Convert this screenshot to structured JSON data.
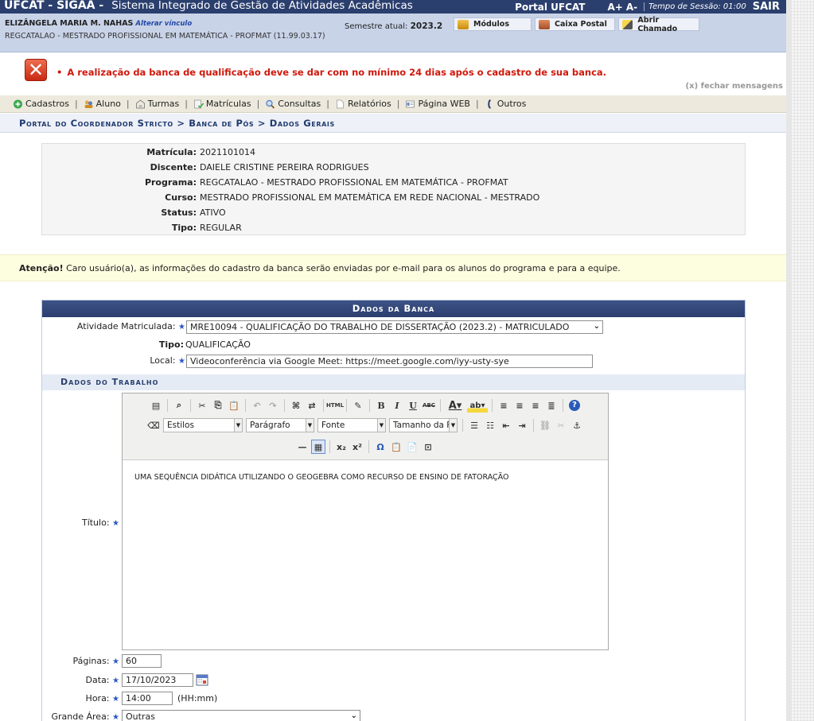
{
  "topbar": {
    "system_name": "UFCAT - SIGAA -",
    "system_full": "Sistema Integrado de Gestão de Atividades Acadêmicas",
    "portal": "Portal UFCAT",
    "font_plus": "A+",
    "font_minus": "A-",
    "session": "Tempo de Sessão: 01:00",
    "logout": "SAIR"
  },
  "user": {
    "name": "ELIZÂNGELA MARIA M. NAHAS",
    "change_link": "Alterar vínculo",
    "program": "REGCATALAO - MESTRADO PROFISSIONAL EM MATEMÁTICA - PROFMAT (11.99.03.17)",
    "semester_label": "Semestre atual:",
    "semester": "2023.2",
    "buttons": {
      "modules": "Módulos",
      "mailbox": "Caixa Postal",
      "ticket": "Abrir Chamado"
    }
  },
  "message": {
    "error": "A realização da banca de qualificação deve se dar com no mínimo 24 dias após o cadastro de sua banca.",
    "close": "(x) fechar mensagens"
  },
  "menu": [
    {
      "label": "Cadastros",
      "icon": "plus-circle-icon",
      "color": "#3aa84a"
    },
    {
      "label": "Aluno",
      "icon": "students-icon",
      "color": "#d79a2b"
    },
    {
      "label": "Turmas",
      "icon": "classroom-icon",
      "color": "#999999"
    },
    {
      "label": "Matrículas",
      "icon": "enroll-icon",
      "color": "#3aa84a"
    },
    {
      "label": "Consultas",
      "icon": "magnifier-icon",
      "color": "#4a78c8"
    },
    {
      "label": "Relatórios",
      "icon": "document-icon",
      "color": "#aaaaaa"
    },
    {
      "label": "Página WEB",
      "icon": "web-page-icon",
      "color": "#5a8ad0"
    },
    {
      "label": "Outros",
      "icon": "phone-icon",
      "color": "#2b3f6e"
    }
  ],
  "breadcrumb": "Portal do Coordenador Stricto > Banca de Pós > Dados Gerais",
  "student": [
    {
      "label": "Matrícula:",
      "value": "2021101014"
    },
    {
      "label": "Discente:",
      "value": "DAIELE CRISTINE PEREIRA RODRIGUES"
    },
    {
      "label": "Programa:",
      "value": "REGCATALAO - MESTRADO PROFISSIONAL EM MATEMÁTICA - PROFMAT"
    },
    {
      "label": "Curso:",
      "value": "MESTRADO PROFISSIONAL EM MATEMÁTICA EM REDE NACIONAL - MESTRADO"
    },
    {
      "label": "Status:",
      "value": "ATIVO"
    },
    {
      "label": "Tipo:",
      "value": "REGULAR"
    }
  ],
  "attention": {
    "title": "Atenção!",
    "text": "Caro usuário(a), as informações do cadastro da banca serão enviadas por e-mail para os alunos do programa e para a equipe."
  },
  "form": {
    "caption": "Dados da Banca",
    "atividade_label": "Atividade Matriculada:",
    "atividade_value": "MRE10094 - QUALIFICAÇÃO DO TRABALHO DE DISSERTAÇÃO (2023.2) - MATRICULADO",
    "tipo_label": "Tipo:",
    "tipo_value": "QUALIFICAÇÃO",
    "local_label": "Local:",
    "local_value": "Videoconferência via Google Meet: https://meet.google.com/iyy-usty-sye",
    "subsection": "Dados do Trabalho",
    "titulo_label": "Título:",
    "editor": {
      "styles": "Estilos",
      "format": "Parágrafo",
      "font": "Fonte",
      "size": "Tamanho da F",
      "content": "UMA SEQUÊNCIA DIDÁTICA UTILIZANDO O GEOGEBRA COMO RECURSO DE ENSINO DE FATORAÇÃO"
    },
    "paginas_label": "Páginas:",
    "paginas_value": "60",
    "data_label": "Data:",
    "data_value": "17/10/2023",
    "hora_label": "Hora:",
    "hora_value": "14:00",
    "hora_hint": "(HH:mm)",
    "area_label": "Grande Área:",
    "area_value": "Outras",
    "required_mark": "★"
  }
}
